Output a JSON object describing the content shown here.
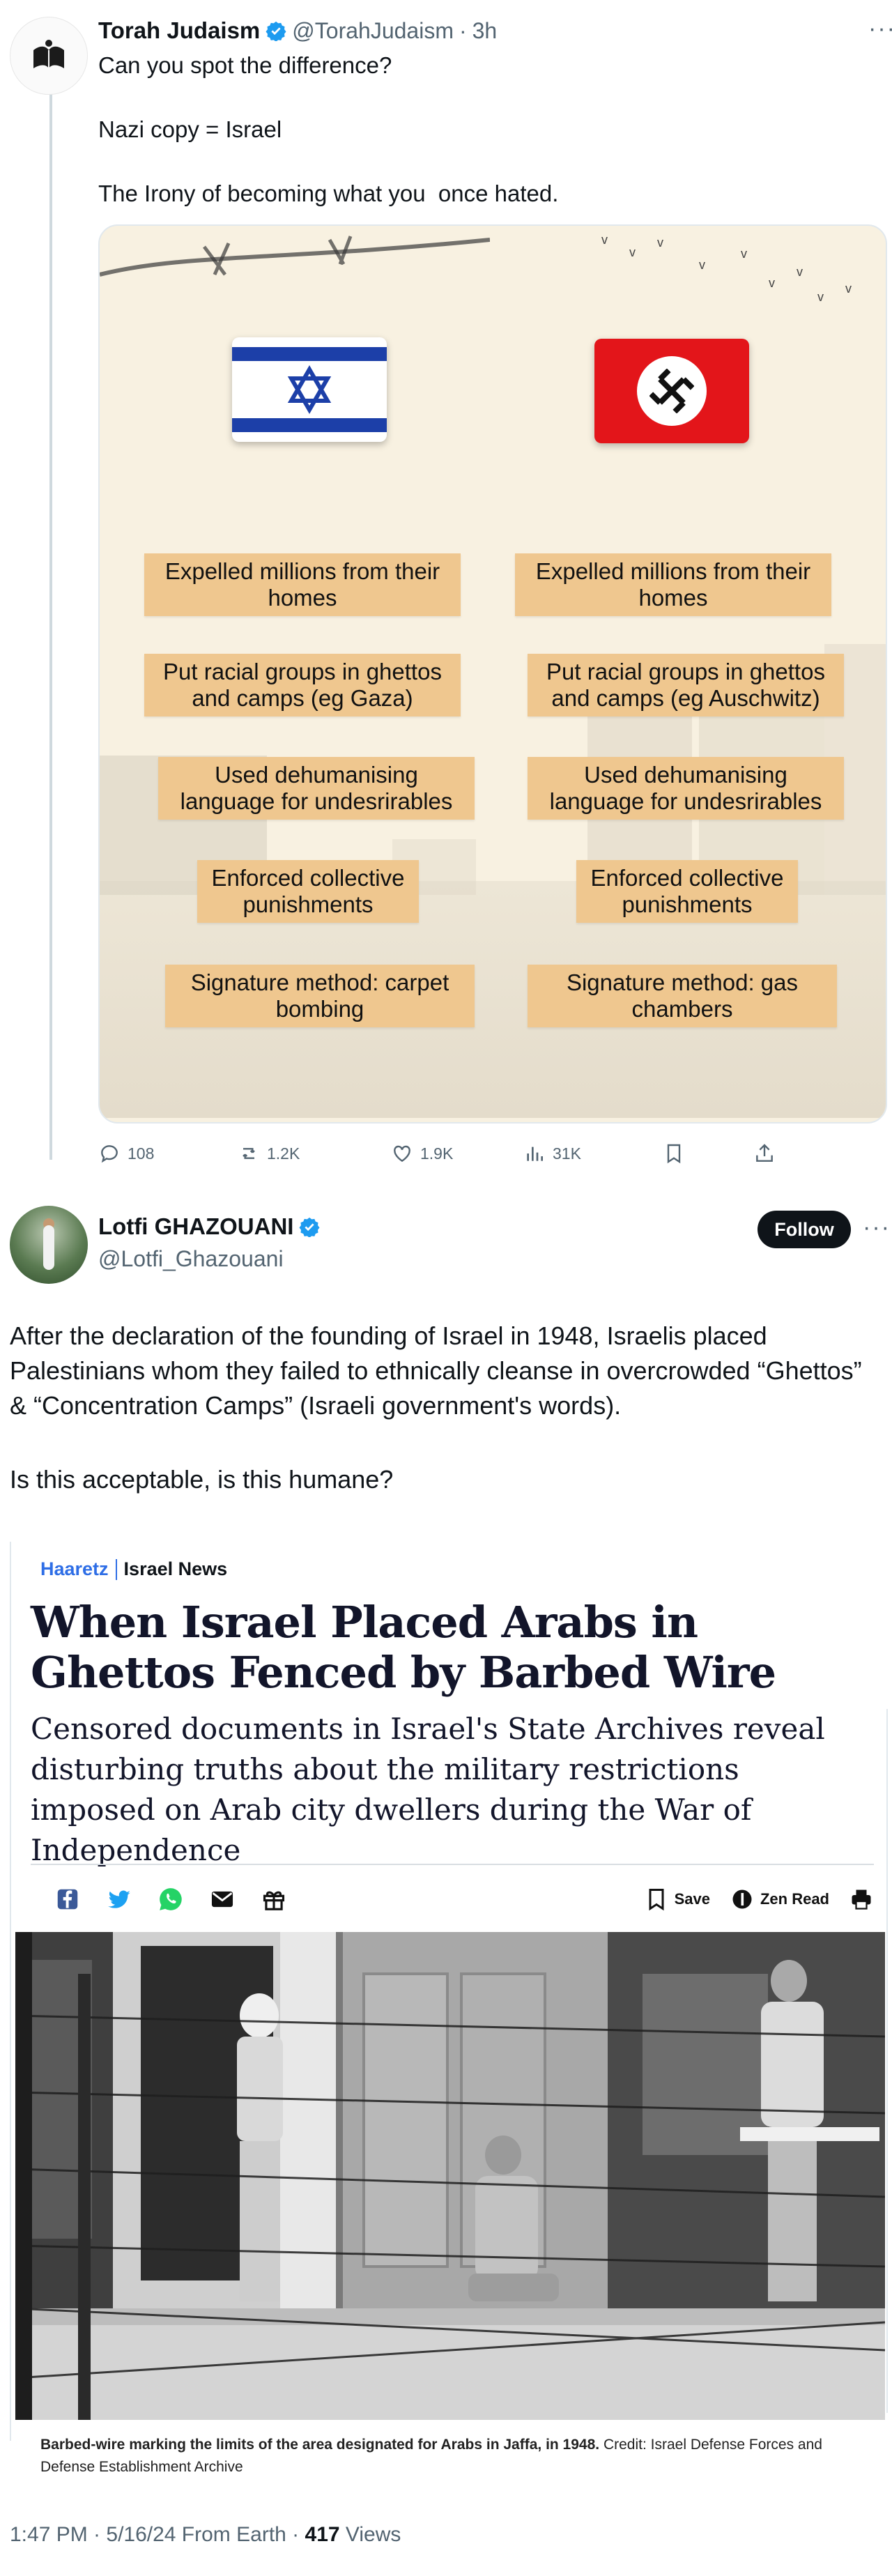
{
  "quoted_tweet": {
    "author_name": "Torah Judaism",
    "handle": "@TorahJudaism",
    "separator": "·",
    "time": "3h",
    "text_line1": "Can you spot the difference?",
    "text_line2": "Nazi copy = Israel",
    "text_line3": "The Irony of becoming what you  once hated.",
    "infographic": {
      "left_items": [
        "Expelled millions from their homes",
        "Put racial groups in ghettos and camps (eg Gaza)",
        "Used dehumanising language for undesrirables",
        "Enforced collective punishments",
        "Signature method: carpet bombing"
      ],
      "right_items": [
        "Expelled millions from their homes",
        "Put racial groups in ghettos and camps (eg Auschwitz)",
        "Used dehumanising language for undesrirables",
        "Enforced collective punishments",
        "Signature method: gas chambers"
      ]
    },
    "actions": {
      "replies": "108",
      "reposts": "1.2K",
      "likes": "1.9K",
      "views": "31K"
    }
  },
  "main_tweet": {
    "author_name": "Lotfi GHAZOUANI",
    "handle": "@Lotfi_Ghazouani",
    "follow_label": "Follow",
    "paragraph1": "After the declaration of the founding of Israel in 1948, Israelis placed Palestinians whom they failed to ethnically cleanse in overcrowded “Ghettos” & “Concentration Camps” (Israeli government's words).",
    "paragraph2": "Is this acceptable, is this humane?",
    "timestamp": "1:47 PM · 5/16/24 From Earth ·",
    "views_count": "417",
    "views_label": "Views"
  },
  "article": {
    "source": "Haaretz",
    "section": "Israel News",
    "title": "When Israel Placed Arabs in Ghettos Fenced by Barbed Wire",
    "subtitle": "Censored documents in Israel's State Archives reveal disturbing truths about the military restrictions imposed on Arab city dwellers during the War of Independence",
    "save_label": "Save",
    "zen_label": "Zen Read",
    "caption_bold": "Barbed-wire marking the limits of the area designated for Arabs in Jaffa, in 1948.",
    "caption_credit": "Credit: Israel Defense Forces and Defense Establishment Archive"
  },
  "colors": {
    "accent": "#1d9bf0",
    "text": "#0f1419",
    "muted": "#536471",
    "chip": "#efc78f",
    "haaretz_blue": "#2e6ee6"
  }
}
